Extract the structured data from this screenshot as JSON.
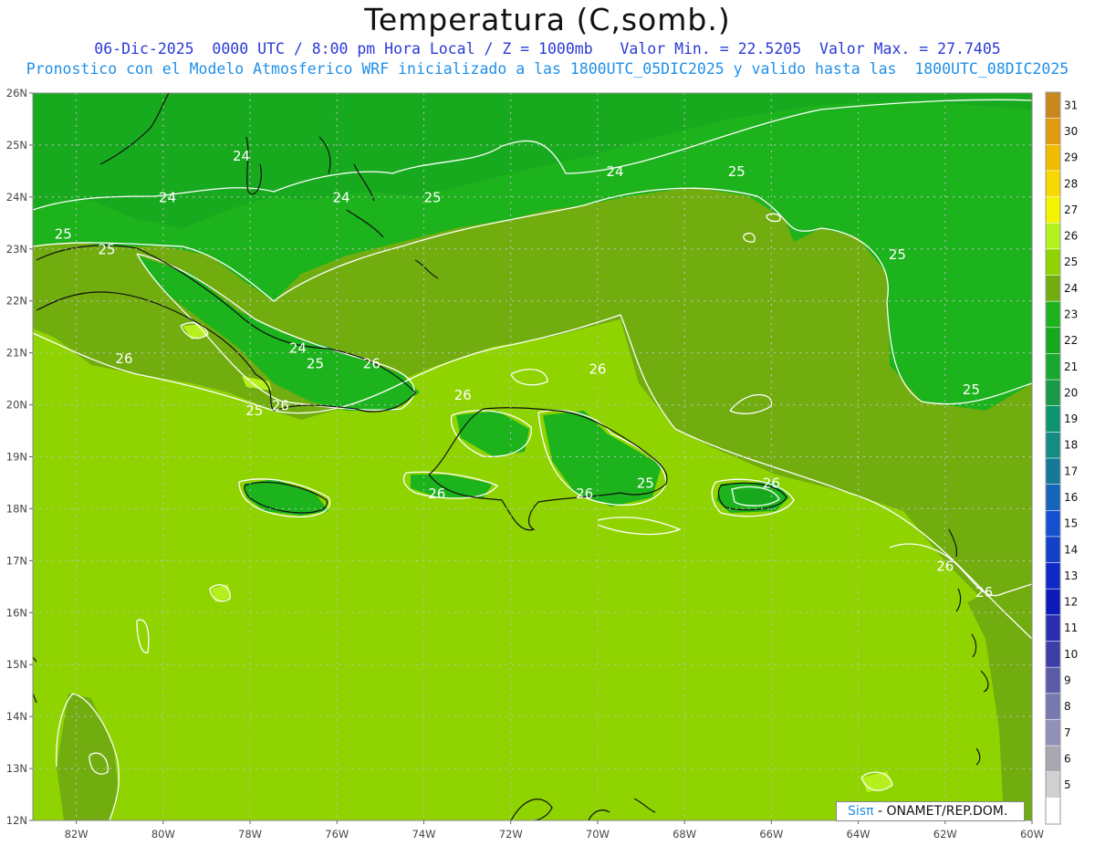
{
  "header": {
    "title": "Temperatura (C,somb.)",
    "line1": "06-Dic-2025  0000 UTC / 8:00 pm Hora Local / Z = 1000mb   Valor Min. = 22.5205  Valor Max. = 27.7405",
    "line2": "Pronostico con el Modelo Atmosferico WRF inicializado a las 1800UTC_05DIC2025 y valido hasta las  1800UTC_08DIC2025"
  },
  "map": {
    "lon_range": [
      -83,
      -60
    ],
    "lat_range": [
      12,
      26
    ],
    "lon_ticks": [
      "82W",
      "80W",
      "78W",
      "76W",
      "74W",
      "72W",
      "70W",
      "68W",
      "66W",
      "64W",
      "62W",
      "60W"
    ],
    "lat_ticks": [
      "12N",
      "13N",
      "14N",
      "15N",
      "16N",
      "17N",
      "18N",
      "19N",
      "20N",
      "21N",
      "22N",
      "23N",
      "24N",
      "25N",
      "26N"
    ],
    "colors": {
      "t23": "#17a81e",
      "t24": "#1cb31c",
      "t25": "#72ad10",
      "t26": "#8fd400",
      "t27": "#b5f01e",
      "coast": "#111111",
      "contour": "#ffffff",
      "grid": "#c0c0c0"
    },
    "contour_labels": [
      {
        "text": "24",
        "lon": -78.2,
        "lat": 24.7
      },
      {
        "text": "24",
        "lon": -79.9,
        "lat": 23.9
      },
      {
        "text": "24",
        "lon": -75.9,
        "lat": 23.9
      },
      {
        "text": "24",
        "lon": -69.6,
        "lat": 24.4
      },
      {
        "text": "25",
        "lon": -73.8,
        "lat": 23.9
      },
      {
        "text": "25",
        "lon": -66.8,
        "lat": 24.4
      },
      {
        "text": "25",
        "lon": -82.3,
        "lat": 23.2
      },
      {
        "text": "25",
        "lon": -81.3,
        "lat": 22.9
      },
      {
        "text": "25",
        "lon": -63.1,
        "lat": 22.8
      },
      {
        "text": "24",
        "lon": -76.9,
        "lat": 21.0
      },
      {
        "text": "25",
        "lon": -76.5,
        "lat": 20.7
      },
      {
        "text": "26",
        "lon": -80.9,
        "lat": 20.8
      },
      {
        "text": "26",
        "lon": -75.2,
        "lat": 20.7
      },
      {
        "text": "26",
        "lon": -70.0,
        "lat": 20.6
      },
      {
        "text": "26",
        "lon": -73.1,
        "lat": 20.1
      },
      {
        "text": "25",
        "lon": -77.9,
        "lat": 19.8
      },
      {
        "text": "26",
        "lon": -77.3,
        "lat": 19.9
      },
      {
        "text": "25",
        "lon": -61.4,
        "lat": 20.2
      },
      {
        "text": "25",
        "lon": -68.9,
        "lat": 18.4
      },
      {
        "text": "26",
        "lon": -70.3,
        "lat": 18.2
      },
      {
        "text": "26",
        "lon": -73.7,
        "lat": 18.2
      },
      {
        "text": "26",
        "lon": -66.0,
        "lat": 18.4
      },
      {
        "text": "26",
        "lon": -62.0,
        "lat": 16.8
      },
      {
        "text": "26",
        "lon": -61.1,
        "lat": 16.3
      }
    ],
    "colorbar": {
      "labels": [
        "31",
        "30",
        "29",
        "28",
        "27",
        "26",
        "25",
        "24",
        "23",
        "22",
        "21",
        "20",
        "19",
        "18",
        "17",
        "16",
        "15",
        "14",
        "13",
        "12",
        "11",
        "10",
        "9",
        "8",
        "7",
        "6",
        "5"
      ],
      "colors": [
        "#c8881e",
        "#e09a10",
        "#f2bc00",
        "#f7d800",
        "#f4f400",
        "#b4f21f",
        "#8fd400",
        "#72ad10",
        "#1cb31c",
        "#17a81e",
        "#18a830",
        "#199a4a",
        "#0f9470",
        "#148c85",
        "#157a98",
        "#1565b8",
        "#1450d0",
        "#1340c8",
        "#0f28c8",
        "#0c1ab8",
        "#2a2db0",
        "#3c3ea8",
        "#5a5ca8",
        "#7878b0",
        "#9090b8",
        "#a8a8b0",
        "#d0d0d0",
        "#ffffff"
      ]
    }
  },
  "credit": {
    "brand": "Sisπ",
    "org": " - ONAMET/REP.DOM."
  }
}
